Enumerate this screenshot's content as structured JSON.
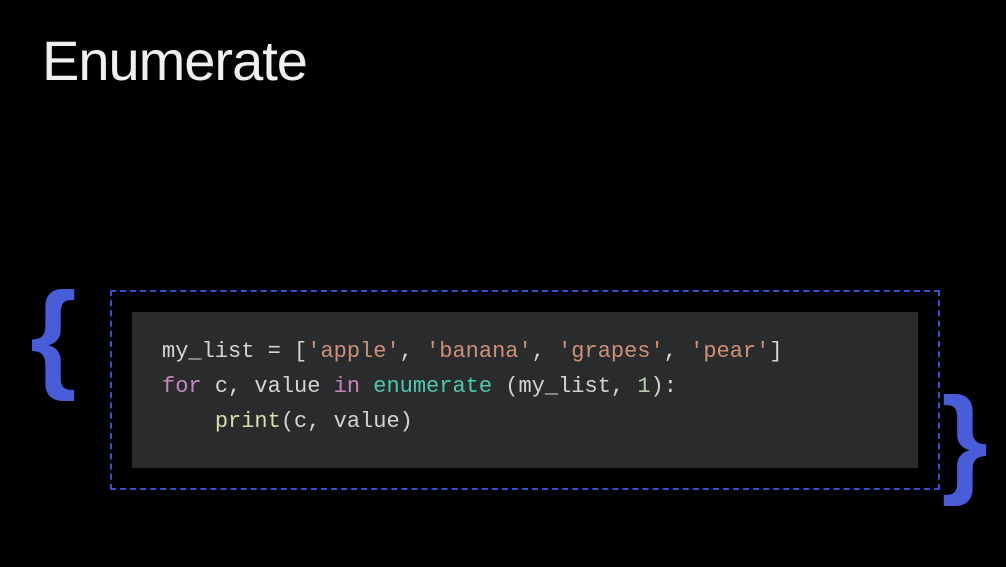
{
  "title": "Enumerate",
  "braces": {
    "left": "{",
    "right": "}"
  },
  "code": {
    "line1": {
      "var": "my_list",
      "eq": " = ",
      "lb": "[",
      "q1a": "'",
      "s1": "apple",
      "q1b": "'",
      "c1": ", ",
      "q2a": "'",
      "s2": "banana",
      "q2b": "'",
      "c2": ", ",
      "q3a": "'",
      "s3": "grapes",
      "q3b": "'",
      "c3": ", ",
      "q4a": "'",
      "s4": "pear",
      "q4b": "'",
      "rb": "]"
    },
    "line2": {
      "kw_for": "for",
      "sp1": " ",
      "v1": "c",
      "comma": ", ",
      "v2": "value",
      "sp2": " ",
      "kw_in": "in",
      "sp3": " ",
      "fn": "enumerate",
      "sp4": " ",
      "lp": "(",
      "arg1": "my_list",
      "argcomma": ", ",
      "num": "1",
      "rp": ")",
      "colon": ":"
    },
    "line3": {
      "indent": "    ",
      "fn": "print",
      "lp": "(",
      "a1": "c",
      "comma": ", ",
      "a2": "value",
      "rp": ")"
    }
  }
}
